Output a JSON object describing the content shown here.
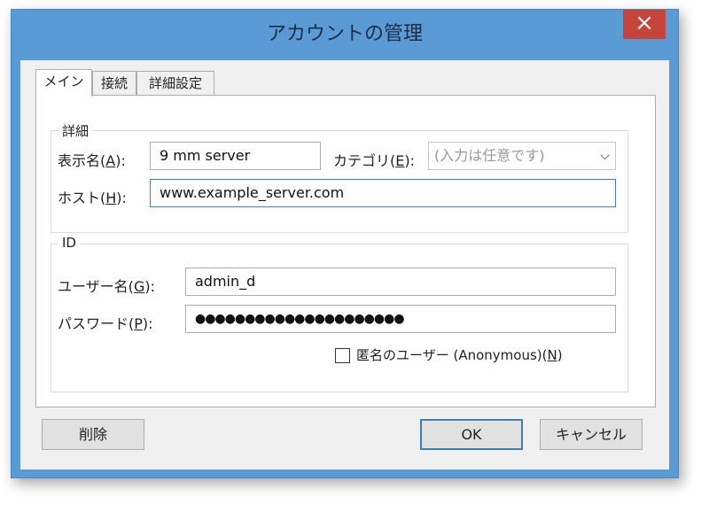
{
  "window": {
    "title": "アカウントの管理",
    "close_label": "×"
  },
  "tabs": [
    {
      "label": "メイン"
    },
    {
      "label": "接続"
    },
    {
      "label": "詳細設定"
    }
  ],
  "details_group": {
    "title": "詳細",
    "display_name_label_pre": "表示名(",
    "display_name_key": "A",
    "display_name_label_post": "):",
    "display_name_value": "9 mm server",
    "category_label_pre": "カテゴリ(",
    "category_key": "E",
    "category_label_post": "):",
    "category_placeholder": "(入力は任意です)",
    "host_label_pre": "ホスト(",
    "host_key": "H",
    "host_label_post": "):",
    "host_value": "www.example_server.com"
  },
  "id_group": {
    "title": "ID",
    "username_label_pre": "ユーザー名(",
    "username_key": "G",
    "username_label_post": "):",
    "username_value": "admin_d",
    "password_label_pre": "パスワード(",
    "password_key": "P",
    "password_label_post": "):",
    "password_value": "●●●●●●●●●●●●●●●●●●●●●",
    "anonymous_label_pre": "匿名のユーザー (Anonymous)(",
    "anonymous_key": "N",
    "anonymous_label_post": ")",
    "anonymous_checked": false
  },
  "buttons": {
    "delete": "削除",
    "ok": "OK",
    "cancel": "キャンセル"
  },
  "colors": {
    "title_bar": "#5b9bd5",
    "close_button": "#c7443a",
    "focus_border": "#3c7fb1"
  }
}
